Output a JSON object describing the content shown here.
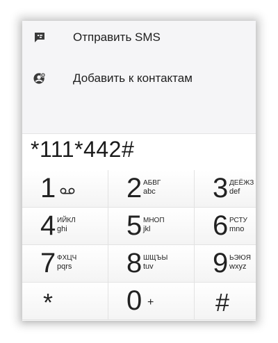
{
  "menu": {
    "items": [
      {
        "label": "Отправить SMS",
        "icon": "sms-icon"
      },
      {
        "label": "Добавить к контактам",
        "icon": "add-contact-icon"
      }
    ]
  },
  "dialer": {
    "number": "*111*442#"
  },
  "keypad": {
    "keys": [
      {
        "digit": "1",
        "cyr": "",
        "lat": "",
        "icon": "voicemail-icon"
      },
      {
        "digit": "2",
        "cyr": "АБВГ",
        "lat": "abc"
      },
      {
        "digit": "3",
        "cyr": "ДЕЁЖЗ",
        "lat": "def"
      },
      {
        "digit": "4",
        "cyr": "ИЙКЛ",
        "lat": "ghi"
      },
      {
        "digit": "5",
        "cyr": "МНОП",
        "lat": "jkl"
      },
      {
        "digit": "6",
        "cyr": "РСТУ",
        "lat": "mno"
      },
      {
        "digit": "7",
        "cyr": "ФХЦЧ",
        "lat": "pqrs"
      },
      {
        "digit": "8",
        "cyr": "ШЩЪЫ",
        "lat": "tuv"
      },
      {
        "digit": "9",
        "cyr": "ЬЭЮЯ",
        "lat": "wxyz"
      },
      {
        "digit": "*"
      },
      {
        "digit": "0",
        "extra": "+"
      },
      {
        "digit": "#"
      }
    ]
  }
}
